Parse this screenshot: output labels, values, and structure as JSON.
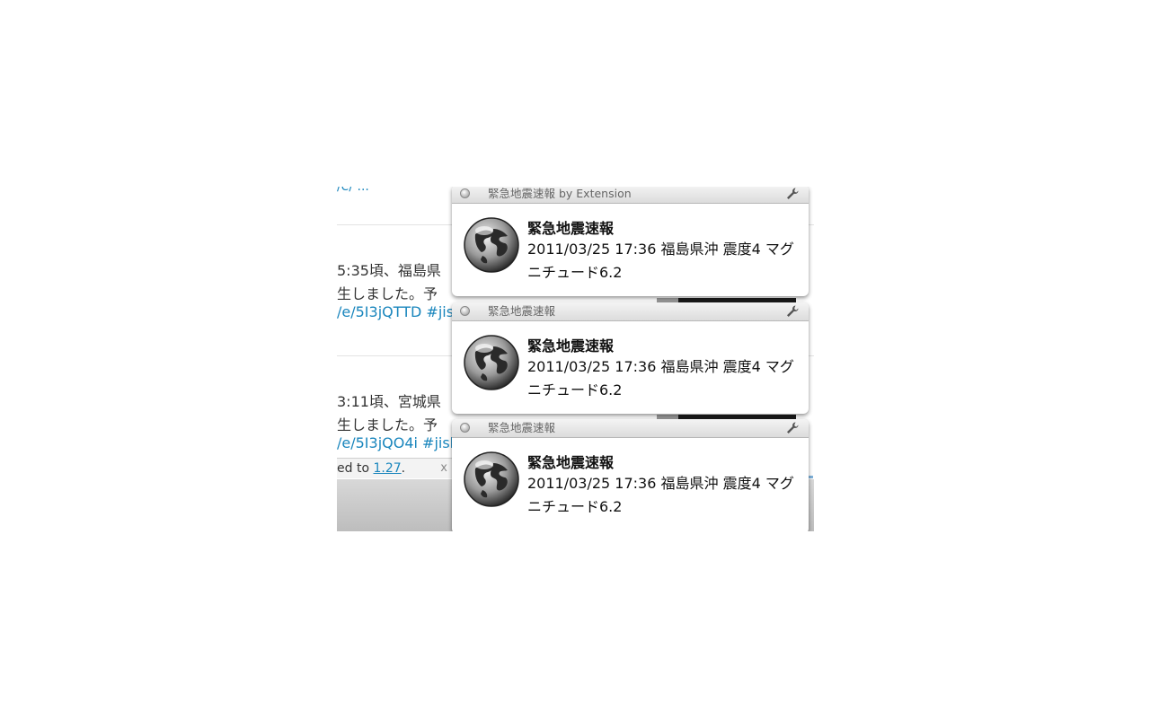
{
  "background": {
    "top_fragment": "/e/ ...",
    "tweets": [
      {
        "line1": "5:35頃、福島県",
        "line2": "生しました。予",
        "link": "/e/5I3jQTTD #jis"
      },
      {
        "line1": "3:11頃、宮城県",
        "line2": "生しました。予",
        "link": "/e/5I3jQO4i #jisl"
      }
    ],
    "status_bar": {
      "prefix": "ed to ",
      "version": "1.27",
      "suffix": ".",
      "close": "x"
    }
  },
  "notifications": [
    {
      "source": "緊急地震速報 by Extension",
      "title": "緊急地震速報",
      "message": "2011/03/25 17:36 福島県沖 震度4 マグニチュード6.2"
    },
    {
      "source": "緊急地震速報",
      "title": "緊急地震速報",
      "message": "2011/03/25 17:36 福島県沖 震度4 マグニチュード6.2"
    },
    {
      "source": "緊急地震速報",
      "title": "緊急地震速報",
      "message": "2011/03/25 17:36 福島県沖 震度4 マグニチュード6.2"
    }
  ],
  "icons": {
    "close": "close-dot-icon",
    "settings": "wrench-icon",
    "app": "globe-icon"
  }
}
